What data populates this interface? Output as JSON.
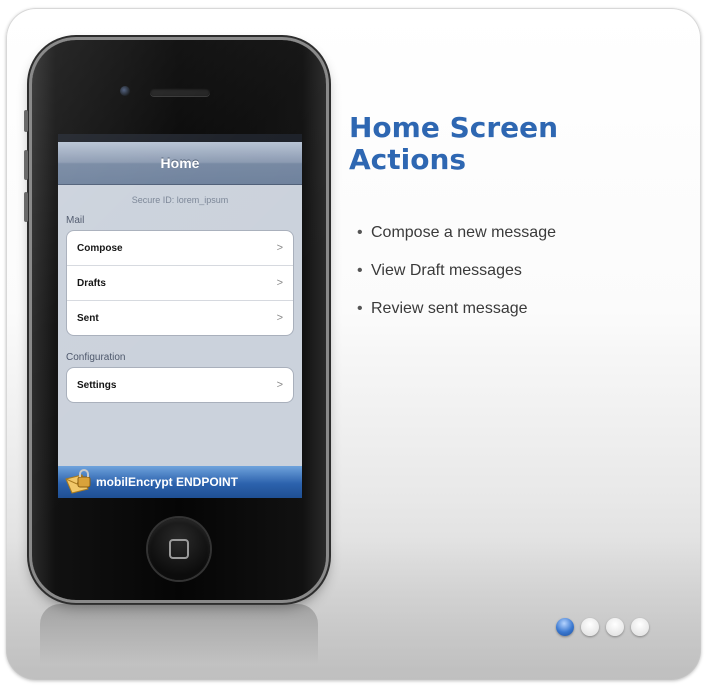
{
  "phone_app": {
    "nav_title": "Home",
    "secure_id": "Secure ID:  lorem_ipsum",
    "mail_section": "Mail",
    "mail_items": [
      {
        "label": "Compose"
      },
      {
        "label": "Drafts"
      },
      {
        "label": "Sent"
      }
    ],
    "config_section": "Configuration",
    "config_items": [
      {
        "label": "Settings"
      }
    ],
    "chevron": ">",
    "brand": "mobilEncrypt ENDPOINT"
  },
  "slide": {
    "title_line1": "Home Screen",
    "title_line2": "Actions",
    "bullets": [
      "Compose a new message",
      "View Draft messages",
      "Review sent message"
    ],
    "bullet_char": "•"
  },
  "pagination": {
    "total": 4,
    "active": 1
  },
  "colors": {
    "title": "#2e67b2",
    "active_dot": "#3a78d0",
    "brand_bar": "#2c62ad"
  }
}
